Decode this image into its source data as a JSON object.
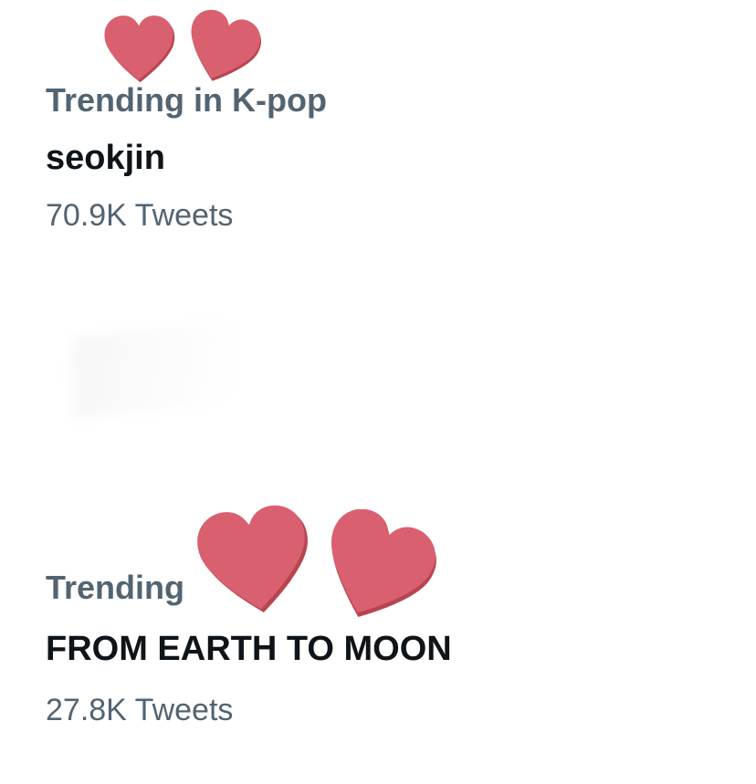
{
  "trends": [
    {
      "context": "Trending in K-pop",
      "topic": "seokjin",
      "count": "70.9K Tweets"
    },
    {
      "context": "Trending",
      "topic": "FROM EARTH TO MOON",
      "count": "27.8K Tweets"
    }
  ],
  "decorations": {
    "icon": "heart-icon",
    "heart_color": "#d9606e",
    "heart_shadow_color": "#b8444f"
  }
}
